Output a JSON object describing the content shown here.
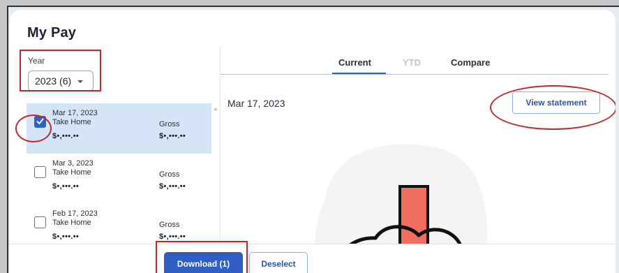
{
  "page": {
    "title": "My Pay"
  },
  "year": {
    "label": "Year",
    "selected": "2023 (6)"
  },
  "pay_list": [
    {
      "date": "Mar 17, 2023",
      "take_home_label": "Take Home",
      "gross_label": "Gross",
      "take_home": "$•,•••.••",
      "gross": "$•,•••.••",
      "checked": true
    },
    {
      "date": "Mar 3, 2023",
      "take_home_label": "Take Home",
      "gross_label": "Gross",
      "take_home": "$•,•••.••",
      "gross": "$•,•••.••",
      "checked": false
    },
    {
      "date": "Feb 17, 2023",
      "take_home_label": "Take Home",
      "gross_label": "Gross",
      "take_home": "$•,•••.••",
      "gross": "$•,•••.••",
      "checked": false
    }
  ],
  "tabs": [
    {
      "label": "Current",
      "active": true
    },
    {
      "label": "YTD",
      "disabled": true
    },
    {
      "label": "Compare"
    }
  ],
  "statement": {
    "date": "Mar 17, 2023",
    "view_button": "View statement"
  },
  "actions": {
    "download": "Download (1)",
    "deselect": "Deselect"
  },
  "colors": {
    "accent": "#2f5fc4",
    "selected_row": "#d6e4f7",
    "annotation": "#c0282d",
    "illustration_red": "#ef6e5f"
  }
}
